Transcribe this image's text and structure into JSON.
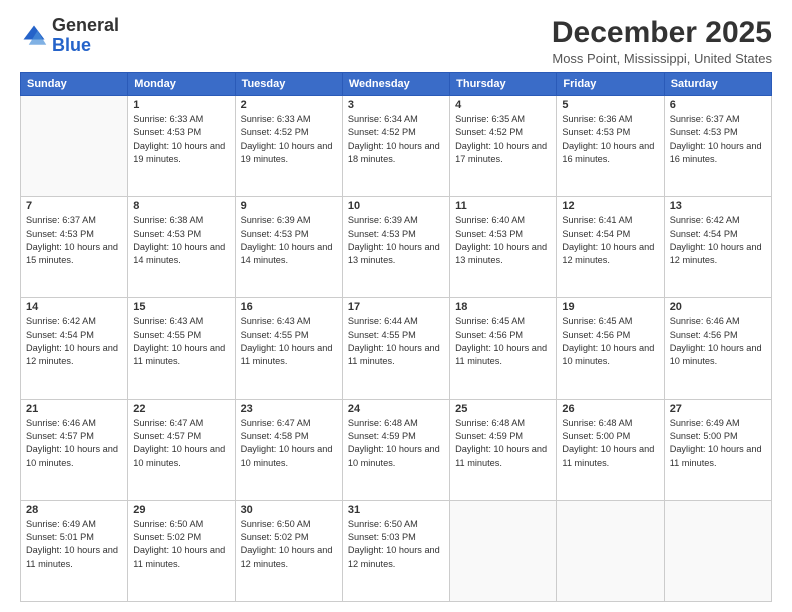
{
  "logo": {
    "general": "General",
    "blue": "Blue"
  },
  "header": {
    "month": "December 2025",
    "location": "Moss Point, Mississippi, United States"
  },
  "weekdays": [
    "Sunday",
    "Monday",
    "Tuesday",
    "Wednesday",
    "Thursday",
    "Friday",
    "Saturday"
  ],
  "weeks": [
    [
      {
        "day": "",
        "sunrise": "",
        "sunset": "",
        "daylight": ""
      },
      {
        "day": "1",
        "sunrise": "Sunrise: 6:33 AM",
        "sunset": "Sunset: 4:53 PM",
        "daylight": "Daylight: 10 hours and 19 minutes."
      },
      {
        "day": "2",
        "sunrise": "Sunrise: 6:33 AM",
        "sunset": "Sunset: 4:52 PM",
        "daylight": "Daylight: 10 hours and 19 minutes."
      },
      {
        "day": "3",
        "sunrise": "Sunrise: 6:34 AM",
        "sunset": "Sunset: 4:52 PM",
        "daylight": "Daylight: 10 hours and 18 minutes."
      },
      {
        "day": "4",
        "sunrise": "Sunrise: 6:35 AM",
        "sunset": "Sunset: 4:52 PM",
        "daylight": "Daylight: 10 hours and 17 minutes."
      },
      {
        "day": "5",
        "sunrise": "Sunrise: 6:36 AM",
        "sunset": "Sunset: 4:53 PM",
        "daylight": "Daylight: 10 hours and 16 minutes."
      },
      {
        "day": "6",
        "sunrise": "Sunrise: 6:37 AM",
        "sunset": "Sunset: 4:53 PM",
        "daylight": "Daylight: 10 hours and 16 minutes."
      }
    ],
    [
      {
        "day": "7",
        "sunrise": "Sunrise: 6:37 AM",
        "sunset": "Sunset: 4:53 PM",
        "daylight": "Daylight: 10 hours and 15 minutes."
      },
      {
        "day": "8",
        "sunrise": "Sunrise: 6:38 AM",
        "sunset": "Sunset: 4:53 PM",
        "daylight": "Daylight: 10 hours and 14 minutes."
      },
      {
        "day": "9",
        "sunrise": "Sunrise: 6:39 AM",
        "sunset": "Sunset: 4:53 PM",
        "daylight": "Daylight: 10 hours and 14 minutes."
      },
      {
        "day": "10",
        "sunrise": "Sunrise: 6:39 AM",
        "sunset": "Sunset: 4:53 PM",
        "daylight": "Daylight: 10 hours and 13 minutes."
      },
      {
        "day": "11",
        "sunrise": "Sunrise: 6:40 AM",
        "sunset": "Sunset: 4:53 PM",
        "daylight": "Daylight: 10 hours and 13 minutes."
      },
      {
        "day": "12",
        "sunrise": "Sunrise: 6:41 AM",
        "sunset": "Sunset: 4:54 PM",
        "daylight": "Daylight: 10 hours and 12 minutes."
      },
      {
        "day": "13",
        "sunrise": "Sunrise: 6:42 AM",
        "sunset": "Sunset: 4:54 PM",
        "daylight": "Daylight: 10 hours and 12 minutes."
      }
    ],
    [
      {
        "day": "14",
        "sunrise": "Sunrise: 6:42 AM",
        "sunset": "Sunset: 4:54 PM",
        "daylight": "Daylight: 10 hours and 12 minutes."
      },
      {
        "day": "15",
        "sunrise": "Sunrise: 6:43 AM",
        "sunset": "Sunset: 4:55 PM",
        "daylight": "Daylight: 10 hours and 11 minutes."
      },
      {
        "day": "16",
        "sunrise": "Sunrise: 6:43 AM",
        "sunset": "Sunset: 4:55 PM",
        "daylight": "Daylight: 10 hours and 11 minutes."
      },
      {
        "day": "17",
        "sunrise": "Sunrise: 6:44 AM",
        "sunset": "Sunset: 4:55 PM",
        "daylight": "Daylight: 10 hours and 11 minutes."
      },
      {
        "day": "18",
        "sunrise": "Sunrise: 6:45 AM",
        "sunset": "Sunset: 4:56 PM",
        "daylight": "Daylight: 10 hours and 11 minutes."
      },
      {
        "day": "19",
        "sunrise": "Sunrise: 6:45 AM",
        "sunset": "Sunset: 4:56 PM",
        "daylight": "Daylight: 10 hours and 10 minutes."
      },
      {
        "day": "20",
        "sunrise": "Sunrise: 6:46 AM",
        "sunset": "Sunset: 4:56 PM",
        "daylight": "Daylight: 10 hours and 10 minutes."
      }
    ],
    [
      {
        "day": "21",
        "sunrise": "Sunrise: 6:46 AM",
        "sunset": "Sunset: 4:57 PM",
        "daylight": "Daylight: 10 hours and 10 minutes."
      },
      {
        "day": "22",
        "sunrise": "Sunrise: 6:47 AM",
        "sunset": "Sunset: 4:57 PM",
        "daylight": "Daylight: 10 hours and 10 minutes."
      },
      {
        "day": "23",
        "sunrise": "Sunrise: 6:47 AM",
        "sunset": "Sunset: 4:58 PM",
        "daylight": "Daylight: 10 hours and 10 minutes."
      },
      {
        "day": "24",
        "sunrise": "Sunrise: 6:48 AM",
        "sunset": "Sunset: 4:59 PM",
        "daylight": "Daylight: 10 hours and 10 minutes."
      },
      {
        "day": "25",
        "sunrise": "Sunrise: 6:48 AM",
        "sunset": "Sunset: 4:59 PM",
        "daylight": "Daylight: 10 hours and 11 minutes."
      },
      {
        "day": "26",
        "sunrise": "Sunrise: 6:48 AM",
        "sunset": "Sunset: 5:00 PM",
        "daylight": "Daylight: 10 hours and 11 minutes."
      },
      {
        "day": "27",
        "sunrise": "Sunrise: 6:49 AM",
        "sunset": "Sunset: 5:00 PM",
        "daylight": "Daylight: 10 hours and 11 minutes."
      }
    ],
    [
      {
        "day": "28",
        "sunrise": "Sunrise: 6:49 AM",
        "sunset": "Sunset: 5:01 PM",
        "daylight": "Daylight: 10 hours and 11 minutes."
      },
      {
        "day": "29",
        "sunrise": "Sunrise: 6:50 AM",
        "sunset": "Sunset: 5:02 PM",
        "daylight": "Daylight: 10 hours and 11 minutes."
      },
      {
        "day": "30",
        "sunrise": "Sunrise: 6:50 AM",
        "sunset": "Sunset: 5:02 PM",
        "daylight": "Daylight: 10 hours and 12 minutes."
      },
      {
        "day": "31",
        "sunrise": "Sunrise: 6:50 AM",
        "sunset": "Sunset: 5:03 PM",
        "daylight": "Daylight: 10 hours and 12 minutes."
      },
      {
        "day": "",
        "sunrise": "",
        "sunset": "",
        "daylight": ""
      },
      {
        "day": "",
        "sunrise": "",
        "sunset": "",
        "daylight": ""
      },
      {
        "day": "",
        "sunrise": "",
        "sunset": "",
        "daylight": ""
      }
    ]
  ]
}
